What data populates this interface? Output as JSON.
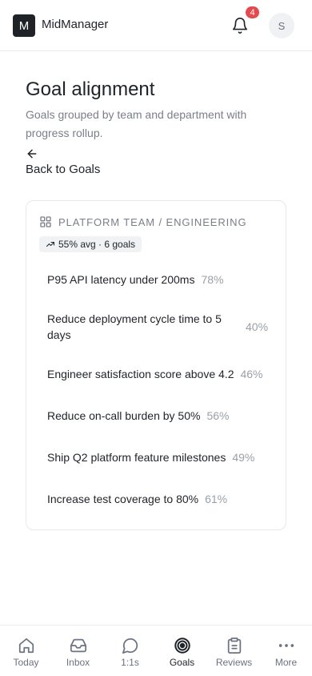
{
  "header": {
    "logo_letter": "M",
    "app_name": "MidManager",
    "notification_count": "4",
    "avatar_initial": "S"
  },
  "page": {
    "title": "Goal alignment",
    "subtitle": "Goals grouped by team and department with progress rollup.",
    "back_label": "Back to Goals"
  },
  "group": {
    "title": "Platform Team / Engineering",
    "rollup": "55% avg · 6 goals",
    "goals": [
      {
        "name": "P95 API latency under 200ms",
        "progress": "78%"
      },
      {
        "name": "Reduce deployment cycle time to 5 days",
        "progress": "40%"
      },
      {
        "name": "Engineer satisfaction score above 4.2",
        "progress": "46%"
      },
      {
        "name": "Reduce on-call burden by 50%",
        "progress": "56%"
      },
      {
        "name": "Ship Q2 platform feature milestones",
        "progress": "49%"
      },
      {
        "name": "Increase test coverage to 80%",
        "progress": "61%"
      }
    ]
  },
  "nav": {
    "items": [
      {
        "label": "Today",
        "icon": "home-icon"
      },
      {
        "label": "Inbox",
        "icon": "inbox-icon"
      },
      {
        "label": "1:1s",
        "icon": "chat-icon"
      },
      {
        "label": "Goals",
        "icon": "target-icon"
      },
      {
        "label": "Reviews",
        "icon": "clipboard-icon"
      },
      {
        "label": "More",
        "icon": "more-icon"
      }
    ],
    "active": "Goals"
  },
  "colors": {
    "accent": "#1f2328",
    "badge": "#e5484d",
    "muted": "#7a7f87"
  }
}
